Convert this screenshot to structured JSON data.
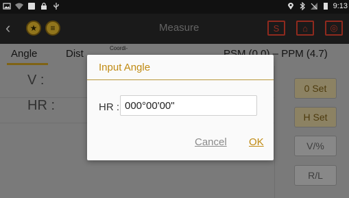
{
  "status_bar": {
    "time": "9:13",
    "left_icons": [
      "image-icon",
      "wifi-icon",
      "battery-box-icon",
      "lock-icon",
      "usb-icon"
    ],
    "right_icons": [
      "location-icon",
      "bluetooth-icon",
      "no-signal-icon",
      "battery-icon"
    ]
  },
  "toolbar": {
    "title": "Measure",
    "s_label": "S",
    "home_label": "⌂",
    "target_label": "◎",
    "back_label": "‹",
    "star_label": "★",
    "list_label": "≡"
  },
  "tabs": {
    "angle": "Angle",
    "dist": "Dist",
    "coord": "Coordi-",
    "psm_ppm": "PSM (0.0) – PPM (4.7)"
  },
  "main": {
    "v_label": "V  :",
    "hr_label": "HR :"
  },
  "right_buttons": {
    "zero_set": "0 Set",
    "h_set": "H Set",
    "v_percent": "V/%",
    "r_l": "R/L"
  },
  "dialog": {
    "title": "Input Angle",
    "field_label": "HR :",
    "field_value": "000°00'00\"",
    "cancel": "Cancel",
    "ok": "OK"
  },
  "colors": {
    "accent": "#c08a12",
    "warning_red": "#c83b2a"
  }
}
